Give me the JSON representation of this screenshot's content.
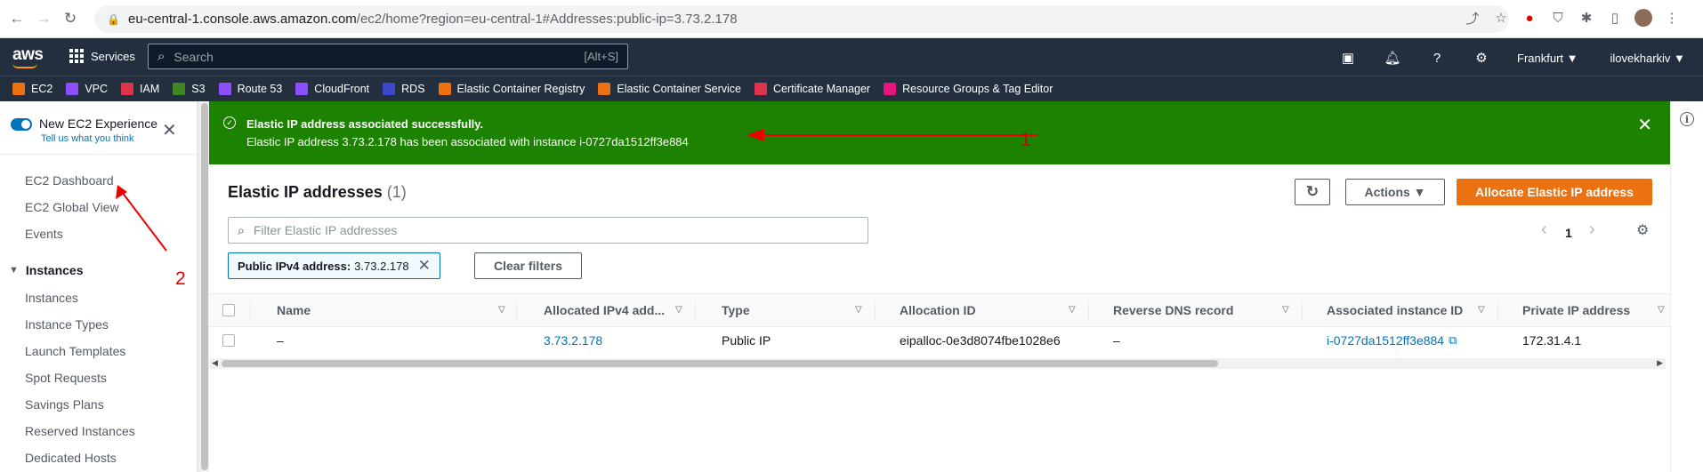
{
  "browser": {
    "url_host": "eu-central-1.console.aws.amazon.com",
    "url_path": "/ec2/home?region=eu-central-1#Addresses:public-ip=3.73.2.178"
  },
  "aws_nav": {
    "logo": "aws",
    "services": "Services",
    "search_placeholder": "Search",
    "search_hint": "[Alt+S]",
    "region": "Frankfurt ▼",
    "user": "ilovekharkiv ▼"
  },
  "favorites": [
    {
      "label": "EC2",
      "color": "#ec7211"
    },
    {
      "label": "VPC",
      "color": "#8c4fff"
    },
    {
      "label": "IAM",
      "color": "#dd344c"
    },
    {
      "label": "S3",
      "color": "#3f8624"
    },
    {
      "label": "Route 53",
      "color": "#8c4fff"
    },
    {
      "label": "CloudFront",
      "color": "#8c4fff"
    },
    {
      "label": "RDS",
      "color": "#3b48cc"
    },
    {
      "label": "Elastic Container Registry",
      "color": "#ec7211"
    },
    {
      "label": "Elastic Container Service",
      "color": "#ec7211"
    },
    {
      "label": "Certificate Manager",
      "color": "#dd344c"
    },
    {
      "label": "Resource Groups & Tag Editor",
      "color": "#e7157b"
    }
  ],
  "sidebar": {
    "new_exp_title": "New EC2 Experience",
    "new_exp_link": "Tell us what you think",
    "items_top": [
      "EC2 Dashboard",
      "EC2 Global View",
      "Events"
    ],
    "section": "Instances",
    "items_instances": [
      "Instances",
      "Instance Types",
      "Launch Templates",
      "Spot Requests",
      "Savings Plans",
      "Reserved Instances",
      "Dedicated Hosts"
    ]
  },
  "flash": {
    "title": "Elastic IP address associated successfully.",
    "body": "Elastic IP address 3.73.2.178 has been associated with instance i-0727da1512ff3e884"
  },
  "annotations": {
    "one": "1",
    "two": "2"
  },
  "page": {
    "title": "Elastic IP addresses",
    "count": "(1)",
    "actions_label": "Actions ▼",
    "allocate_label": "Allocate Elastic IP address",
    "filter_placeholder": "Filter Elastic IP addresses",
    "page_number": "1",
    "token_key": "Public IPv4 address:",
    "token_value": "3.73.2.178",
    "clear_filters": "Clear filters"
  },
  "table": {
    "headers": [
      "Name",
      "Allocated IPv4 add...",
      "Type",
      "Allocation ID",
      "Reverse DNS record",
      "Associated instance ID",
      "Private IP address"
    ],
    "row": [
      "–",
      "3.73.2.178",
      "Public IP",
      "eipalloc-0e3d8074fbe1028e6",
      "–",
      "i-0727da1512ff3e884",
      "172.31.4.1"
    ]
  },
  "colors": {
    "success": "#1d8102",
    "primary": "#ec7211",
    "nav": "#232f3e",
    "link": "#0073bb",
    "annotation": "#ee0000"
  }
}
